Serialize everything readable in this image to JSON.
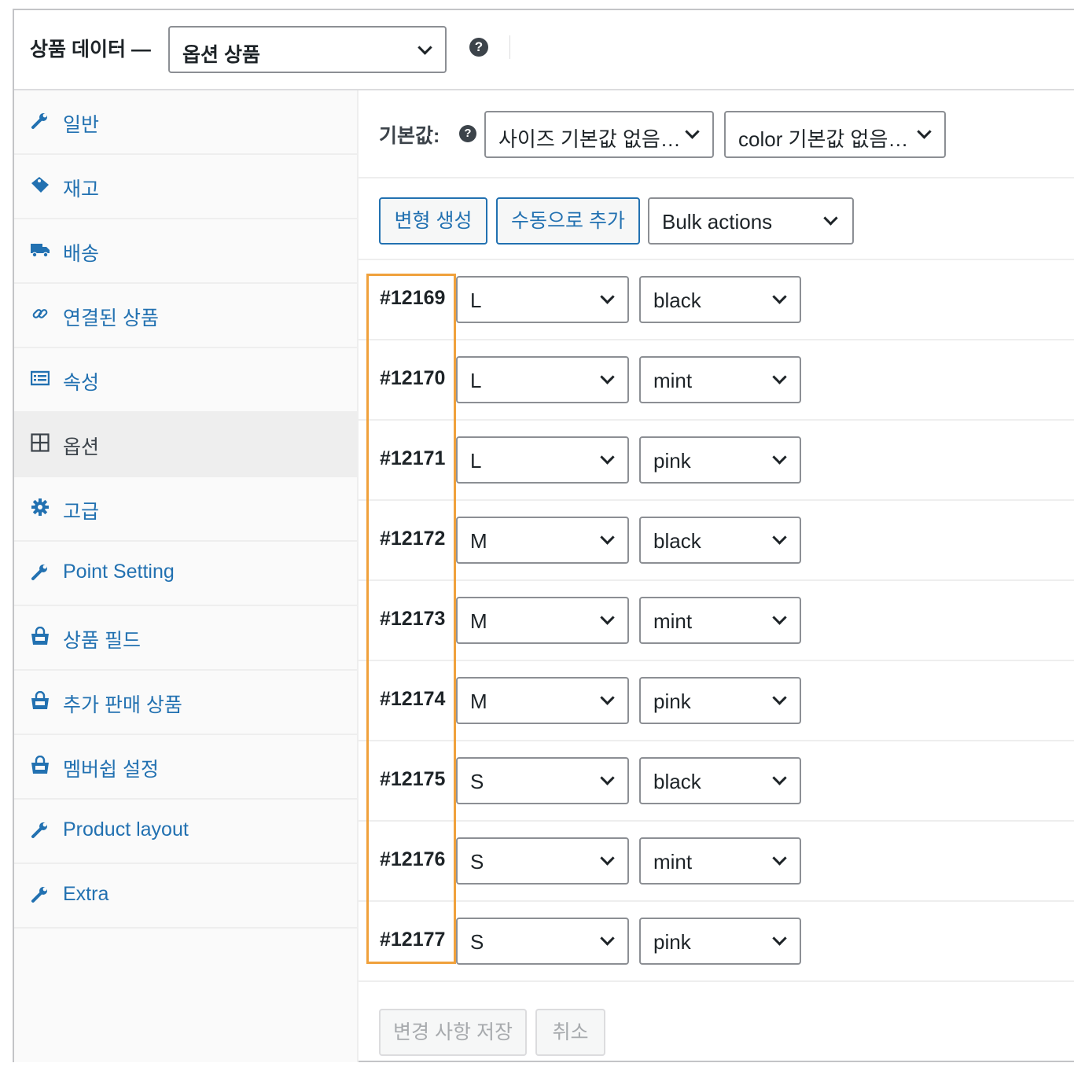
{
  "header": {
    "label": "상품 데이터 —",
    "product_type": "옵션 상품"
  },
  "sidebar": {
    "items": [
      {
        "label": "일반",
        "icon": "wrench-icon"
      },
      {
        "label": "재고",
        "icon": "tag-icon"
      },
      {
        "label": "배송",
        "icon": "truck-icon"
      },
      {
        "label": "연결된 상품",
        "icon": "link-icon"
      },
      {
        "label": "속성",
        "icon": "list-icon"
      },
      {
        "label": "옵션",
        "icon": "grid-icon",
        "active": true
      },
      {
        "label": "고급",
        "icon": "gear-icon"
      },
      {
        "label": "Point Setting",
        "icon": "wrench-icon"
      },
      {
        "label": "상품 필드",
        "icon": "shopping-bag-icon"
      },
      {
        "label": "추가 판매 상품",
        "icon": "shopping-bag-icon"
      },
      {
        "label": "멤버쉽 설정",
        "icon": "shopping-bag-icon"
      },
      {
        "label": "Product layout",
        "icon": "wrench-icon"
      },
      {
        "label": "Extra",
        "icon": "wrench-icon"
      }
    ]
  },
  "defaults": {
    "label": "기본값:",
    "size_default": "사이즈 기본값 없음…",
    "color_default": "color 기본값 없음…"
  },
  "actions": {
    "generate": "변형 생성",
    "add_manually": "수동으로 추가",
    "bulk_actions": "Bulk actions"
  },
  "variations": [
    {
      "id": "#12169",
      "size": "L",
      "color": "black"
    },
    {
      "id": "#12170",
      "size": "L",
      "color": "mint"
    },
    {
      "id": "#12171",
      "size": "L",
      "color": "pink"
    },
    {
      "id": "#12172",
      "size": "M",
      "color": "black"
    },
    {
      "id": "#12173",
      "size": "M",
      "color": "mint"
    },
    {
      "id": "#12174",
      "size": "M",
      "color": "pink"
    },
    {
      "id": "#12175",
      "size": "S",
      "color": "black"
    },
    {
      "id": "#12176",
      "size": "S",
      "color": "mint"
    },
    {
      "id": "#12177",
      "size": "S",
      "color": "pink"
    }
  ],
  "footer": {
    "save": "변경 사항 저장",
    "cancel": "취소"
  },
  "colors": {
    "link": "#2271b1",
    "highlight": "#f0a13c"
  }
}
